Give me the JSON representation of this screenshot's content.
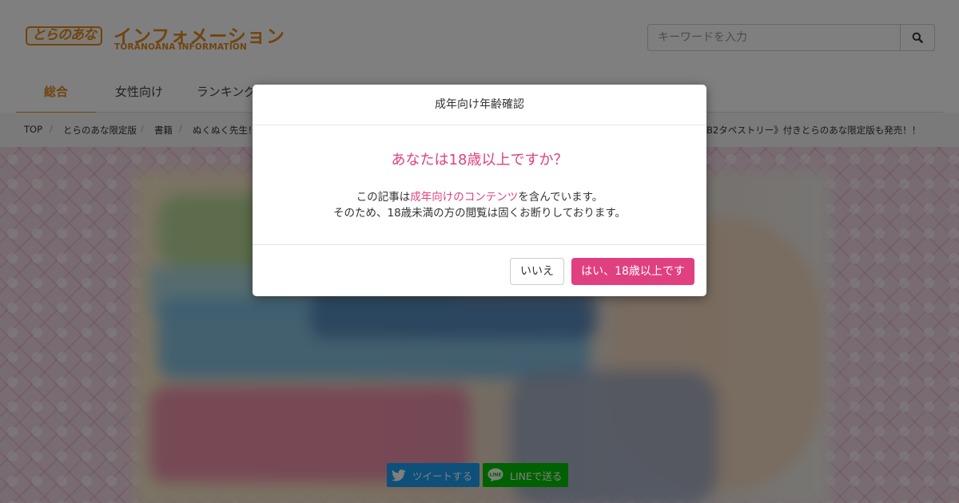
{
  "header": {
    "logo_badge": "とらのあな",
    "logo_title": "インフォメーション",
    "logo_subtitle": "TORANOANA INFORMATION",
    "search": {
      "placeholder": "キーワードを入力"
    }
  },
  "nav": {
    "tabs": [
      {
        "label": "総合",
        "active": true
      },
      {
        "label": "女性向け",
        "active": false
      },
      {
        "label": "ランキング",
        "active": false
      }
    ]
  },
  "breadcrumb": {
    "items": [
      "TOP",
      "とらのあな限定版",
      "書籍",
      "ぬくぬく先生！"
    ],
    "trailing_text": "B2タペストリー》付きとらのあな限定版も発売！！"
  },
  "share": {
    "twitter_label": "ツイートする",
    "line_label": "LINEで送る"
  },
  "modal": {
    "title": "成年向け年齢確認",
    "question": "あなたは18歳以上ですか？",
    "line1_prefix": "この記事は",
    "line1_highlight": "成年向けのコンテンツ",
    "line1_suffix": "を含んでいます。",
    "line2": "そのため、18歳未満の方の閲覧は固くお断りしております。",
    "no_label": "いいえ",
    "yes_label": "はい、18歳以上です"
  },
  "colors": {
    "brand_orange": "#e08a1e",
    "accent_pink": "#e0407f",
    "twitter_blue": "#1da1f2",
    "line_green": "#00c300"
  }
}
